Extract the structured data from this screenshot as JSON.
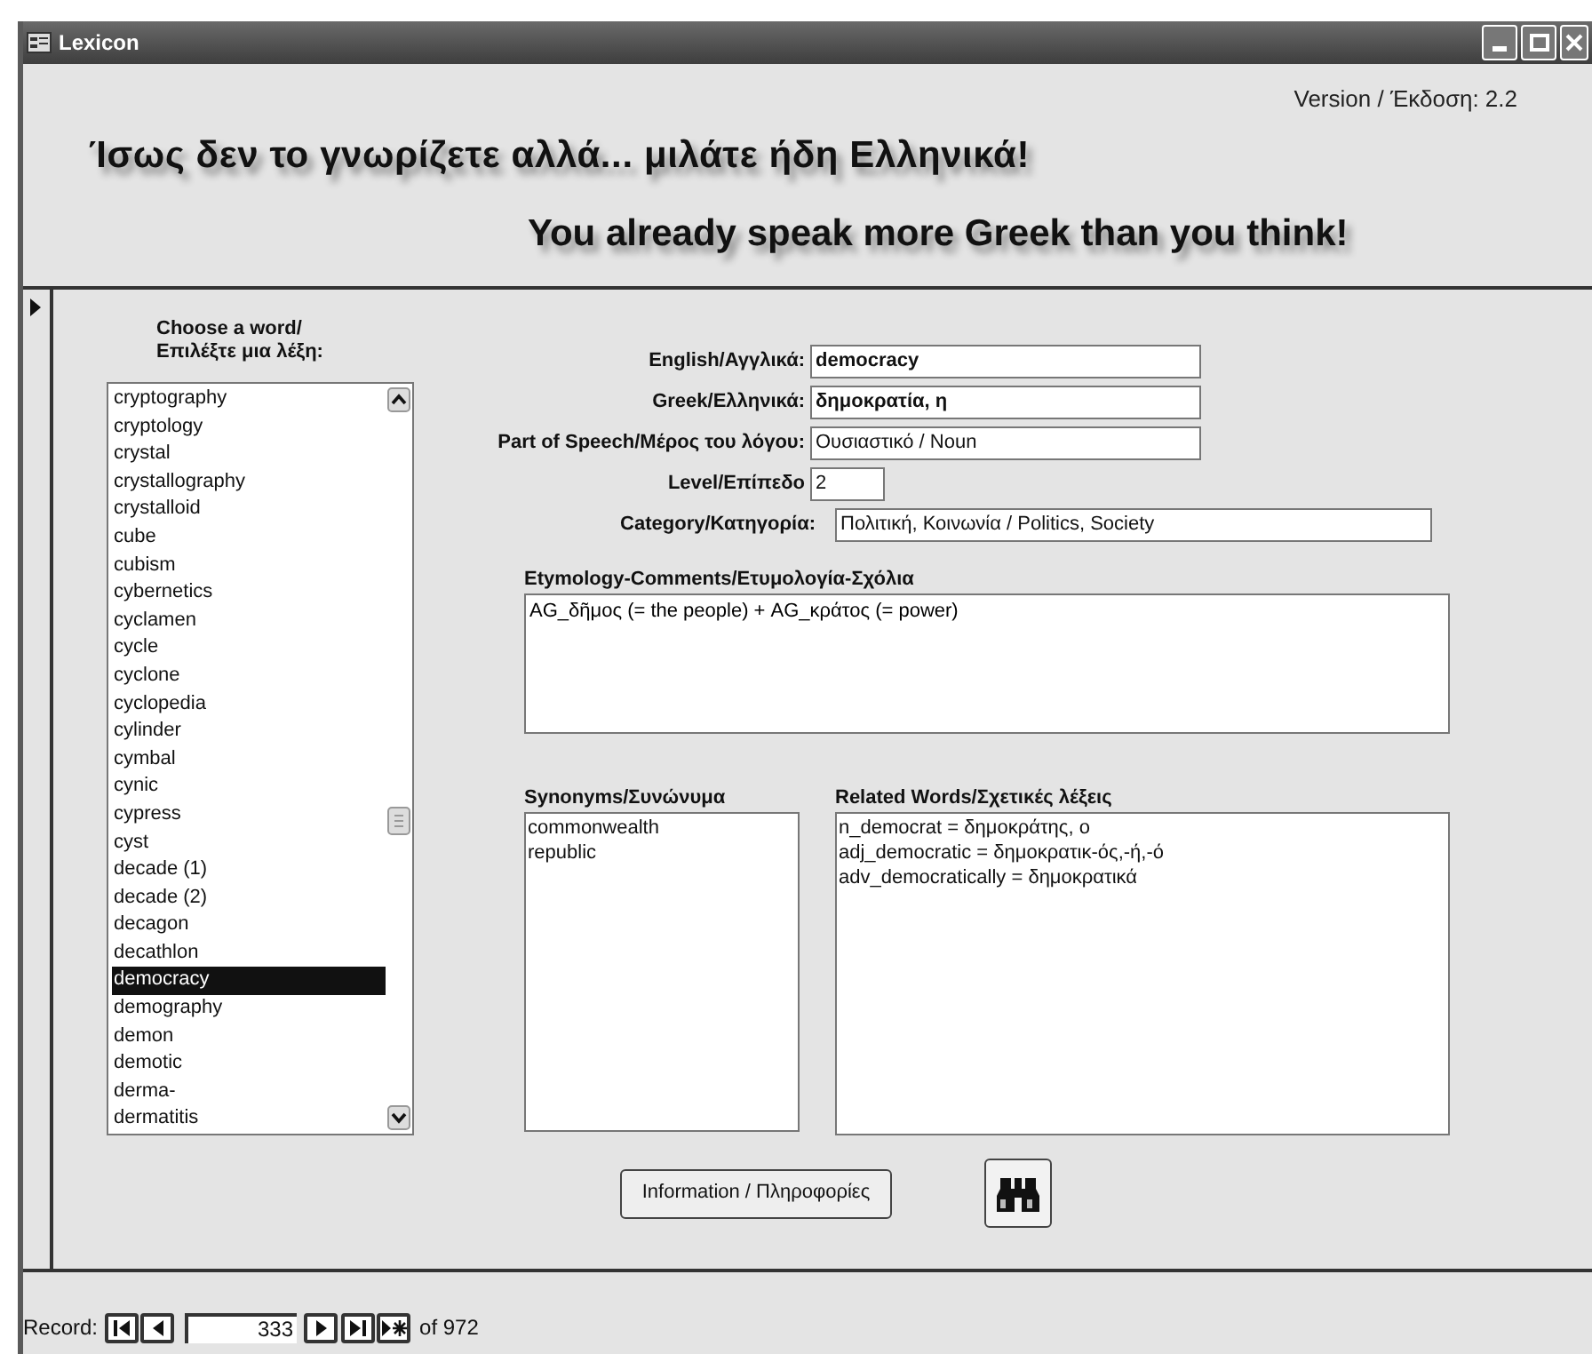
{
  "window": {
    "title": "Lexicon"
  },
  "version": "Version / Έκδοση: 2.2",
  "headline_greek": "Ίσως δεν το γνωρίζετε αλλά... μιλάτε ήδη Ελληνικά!",
  "headline_english": "You already speak more Greek than you think!",
  "word_list": {
    "heading": "Choose a word/\nΕπιλέξτε μια λέξη:",
    "items": [
      {
        "label": "cryptography",
        "selected": false
      },
      {
        "label": "cryptology",
        "selected": false
      },
      {
        "label": "crystal",
        "selected": false
      },
      {
        "label": "crystallography",
        "selected": false
      },
      {
        "label": "crystalloid",
        "selected": false
      },
      {
        "label": "cube",
        "selected": false
      },
      {
        "label": "cubism",
        "selected": false
      },
      {
        "label": "cybernetics",
        "selected": false
      },
      {
        "label": "cyclamen",
        "selected": false
      },
      {
        "label": "cycle",
        "selected": false
      },
      {
        "label": "cyclone",
        "selected": false
      },
      {
        "label": "cyclopedia",
        "selected": false
      },
      {
        "label": "cylinder",
        "selected": false
      },
      {
        "label": "cymbal",
        "selected": false
      },
      {
        "label": "cynic",
        "selected": false
      },
      {
        "label": "cypress",
        "selected": false
      },
      {
        "label": "cyst",
        "selected": false
      },
      {
        "label": "decade (1)",
        "selected": false
      },
      {
        "label": "decade (2)",
        "selected": false
      },
      {
        "label": "decagon",
        "selected": false
      },
      {
        "label": "decathlon",
        "selected": false
      },
      {
        "label": "democracy",
        "selected": true
      },
      {
        "label": "demography",
        "selected": false
      },
      {
        "label": "demon",
        "selected": false
      },
      {
        "label": "demotic",
        "selected": false
      },
      {
        "label": "derma-",
        "selected": false
      },
      {
        "label": "dermatitis",
        "selected": false
      }
    ]
  },
  "fields": [
    {
      "label": "English/Αγγλικά:",
      "value": "democracy",
      "bold": true
    },
    {
      "label": "Greek/Ελληνικά:",
      "value": "δημοκρατία, η",
      "bold": true
    },
    {
      "label": "Part of Speech/Μέρος του λόγου:",
      "value": "Ουσιαστικό / Noun",
      "bold": false
    },
    {
      "label": "Level/Επίπεδο",
      "value": "2",
      "bold": false
    },
    {
      "label": "Category/Κατηγορία:",
      "value": "Πολιτική, Κοινωνία / Politics, Society",
      "bold": false
    }
  ],
  "etymology": {
    "label": "Etymology-Comments/Ετυμολογία-Σχόλια",
    "text": "AG_δῆμος (= the people) + AG_κράτος (= power)"
  },
  "synonyms": {
    "label": "Synonyms/Συνώνυμα",
    "items": [
      "commonwealth",
      "republic"
    ]
  },
  "related_words": {
    "label": "Related Words/Σχετικές λέξεις",
    "items": [
      "n_democrat = δημοκράτης, ο",
      "adj_democratic = δημοκρατικ-ός,-ή,-ό",
      "adv_democratically = δημοκρατικά"
    ]
  },
  "info_button": "Information / Πληροφορίες",
  "record_nav": {
    "label": "Record:",
    "current": "333",
    "total": "of 972"
  }
}
